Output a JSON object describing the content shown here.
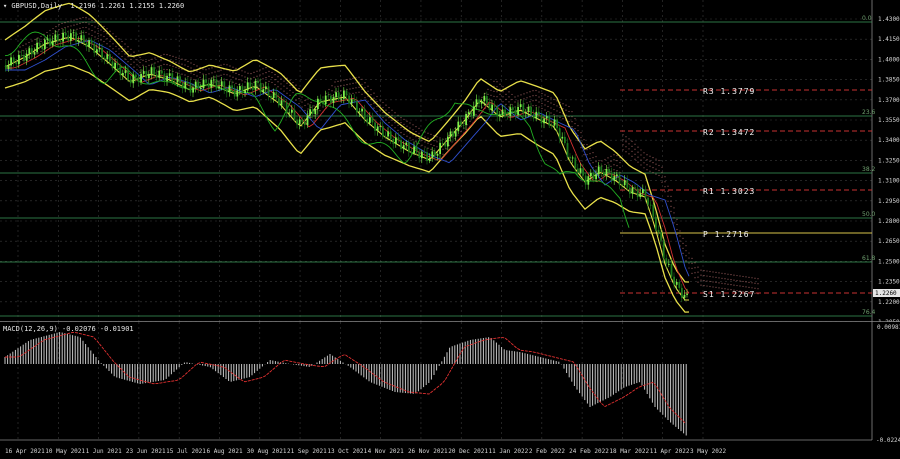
{
  "header": {
    "symbol_line": "▾ GBPUSD,Daily  1.2196 1.2261 1.2155 1.2260"
  },
  "macd": {
    "label": "MACD(12,26,9) -0.02076 -0.01901",
    "top_value": "0.00981",
    "bottom_value": "-0.02245"
  },
  "price_axis": {
    "labels": [
      "1.4300",
      "1.4150",
      "1.4000",
      "1.3850",
      "1.3700",
      "1.3550",
      "1.3400",
      "1.3250",
      "1.3100",
      "1.2950",
      "1.2800",
      "1.2650",
      "1.2500",
      "1.2350",
      "1.2200",
      "1.2050"
    ],
    "current_price": "1.2260"
  },
  "time_axis": {
    "labels": [
      "16 Apr 2021",
      "10 May 2021",
      "1 Jun 2021",
      "23 Jun 2021",
      "15 Jul 2021",
      "6 Aug 2021",
      "30 Aug 2021",
      "21 Sep 2021",
      "13 Oct 2021",
      "4 Nov 2021",
      "26 Nov 2021",
      "20 Dec 2021",
      "11 Jan 2022",
      "2 Feb 2022",
      "24 Feb 2022",
      "18 Mar 2022",
      "11 Apr 2022",
      "3 May 2022"
    ]
  },
  "pivots": [
    {
      "label": "R3  1.3779",
      "color": "#c83232"
    },
    {
      "label": "R2  1.3472",
      "color": "#c83232"
    },
    {
      "label": "R1  1.3023",
      "color": "#c83232"
    },
    {
      "label": "P   1.2716",
      "color": "#d9c34a"
    },
    {
      "label": "S1  1.2267",
      "color": "#c83232"
    }
  ],
  "fib_levels": [
    "0.0",
    "23.6",
    "38.2",
    "50.0",
    "61.8",
    "76.4"
  ],
  "colors": {
    "grid": "#3a3a3a",
    "bull": "#7cf04a",
    "bear": "#1c7a1c",
    "bollinger": "#e8e04a",
    "fib": "#3d9a5a",
    "macd_hist": "#c8c8c8",
    "macd_signal": "#e03030"
  }
}
